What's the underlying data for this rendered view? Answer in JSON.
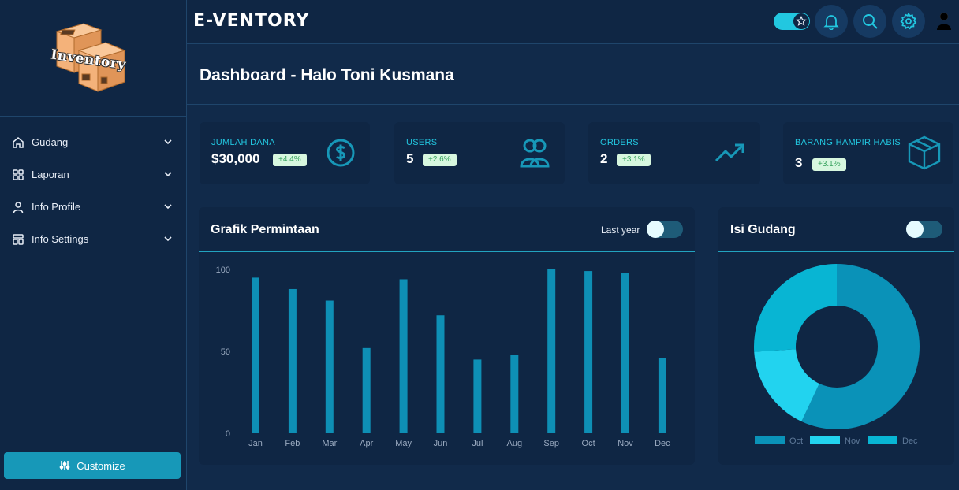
{
  "sidebar": {
    "logo_text": "Inventory",
    "items": [
      {
        "label": "Gudang",
        "icon": "home-icon"
      },
      {
        "label": "Laporan",
        "icon": "grid-icon"
      },
      {
        "label": "Info Profile",
        "icon": "user-icon"
      },
      {
        "label": "Info Settings",
        "icon": "settings-layout-icon"
      }
    ],
    "customize_label": "Customize"
  },
  "topbar": {
    "brand": "E-VENTORY",
    "icons": [
      "theme-toggle",
      "bell-icon",
      "search-icon",
      "gear-icon",
      "user-avatar-icon"
    ]
  },
  "header": {
    "title": "Dashboard - Halo Toni Kusmana"
  },
  "cards": [
    {
      "title": "JUMLAH DANA",
      "value": "$30,000",
      "badge": "+4.4%",
      "icon": "dollar-icon"
    },
    {
      "title": "USERS",
      "value": "5",
      "badge": "+2.6%",
      "icon": "users-icon"
    },
    {
      "title": "ORDERS",
      "value": "2",
      "badge": "+3.1%",
      "icon": "trending-up-icon"
    },
    {
      "title": "BARANG HAMPIR HABIS",
      "value": "3",
      "badge": "+3.1%",
      "icon": "box-icon"
    }
  ],
  "bar_panel": {
    "title": "Grafik Permintaan",
    "toggle_label": "Last year"
  },
  "pie_panel": {
    "title": "Isi Gudang"
  },
  "colors": {
    "accent": "#22c7e0",
    "bar": "#0e8fb5",
    "card_bg": "#0f2644",
    "page_bg": "#112a4a"
  },
  "chart_data": [
    {
      "type": "bar",
      "categories": [
        "Jan",
        "Feb",
        "Mar",
        "Apr",
        "May",
        "Jun",
        "Jul",
        "Aug",
        "Sep",
        "Oct",
        "Nov",
        "Dec"
      ],
      "values": [
        95,
        88,
        81,
        52,
        94,
        72,
        45,
        48,
        100,
        99,
        98,
        46
      ],
      "ylim": [
        0,
        100
      ],
      "yticks": [
        0,
        50,
        100
      ],
      "grid": false
    },
    {
      "type": "pie",
      "donut": true,
      "categories": [
        "Oct",
        "Nov",
        "Dec"
      ],
      "series": [
        {
          "name": "Oct",
          "value": 57,
          "color": "#0a92b8"
        },
        {
          "name": "Nov",
          "value": 17,
          "color": "#22d3ef"
        },
        {
          "name": "Dec",
          "value": 26,
          "color": "#08b5d3"
        }
      ],
      "legend": "bottom"
    }
  ]
}
